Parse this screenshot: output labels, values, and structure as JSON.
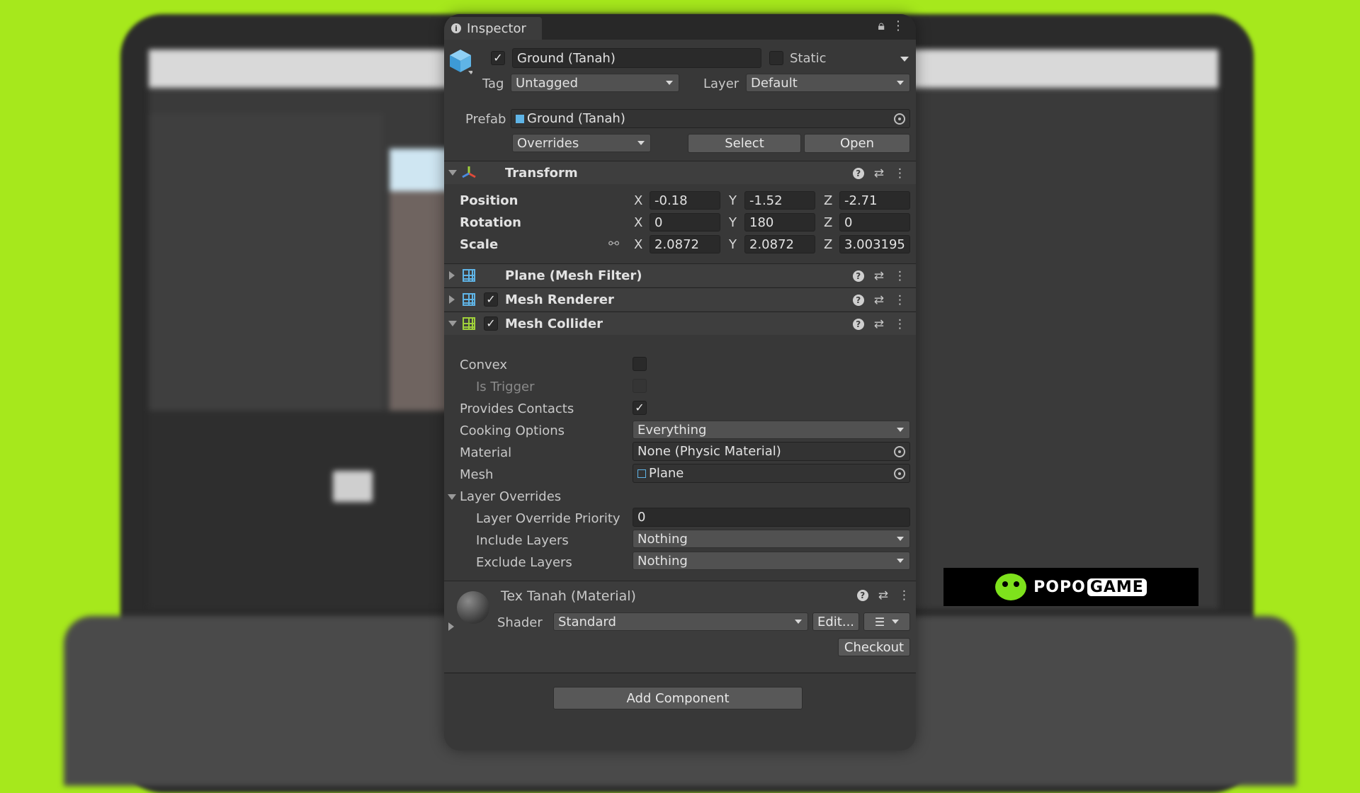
{
  "inspector": {
    "tab_label": "Inspector",
    "object": {
      "name": "Ground (Tanah)",
      "enabled": true,
      "static_label": "Static",
      "static_checked": false,
      "tag_label": "Tag",
      "tag_value": "Untagged",
      "layer_label": "Layer",
      "layer_value": "Default",
      "prefab_label": "Prefab",
      "prefab_value": "Ground (Tanah)",
      "overrides_label": "Overrides",
      "select_label": "Select",
      "open_label": "Open"
    },
    "transform": {
      "title": "Transform",
      "rows": [
        {
          "label": "Position",
          "x": "-0.18",
          "y": "-1.52",
          "z": "-2.71"
        },
        {
          "label": "Rotation",
          "x": "0",
          "y": "180",
          "z": "0"
        },
        {
          "label": "Scale",
          "x": "2.0872",
          "y": "2.0872",
          "z": "3.003195"
        }
      ],
      "axis_x": "X",
      "axis_y": "Y",
      "axis_z": "Z"
    },
    "components": {
      "mesh_filter": {
        "title": "Plane (Mesh Filter)"
      },
      "mesh_renderer": {
        "title": "Mesh Renderer",
        "enabled": true
      },
      "mesh_collider": {
        "title": "Mesh Collider",
        "enabled": true
      }
    },
    "collider": {
      "convex_label": "Convex",
      "convex_checked": false,
      "is_trigger_label": "Is Trigger",
      "provides_contacts_label": "Provides Contacts",
      "provides_contacts_checked": true,
      "cooking_options_label": "Cooking Options",
      "cooking_options_value": "Everything",
      "material_label": "Material",
      "material_value": "None (Physic Material)",
      "mesh_label": "Mesh",
      "mesh_value": "Plane",
      "layer_overrides_label": "Layer Overrides",
      "layer_override_priority_label": "Layer Override Priority",
      "layer_override_priority_value": "0",
      "include_layers_label": "Include Layers",
      "include_layers_value": "Nothing",
      "exclude_layers_label": "Exclude Layers",
      "exclude_layers_value": "Nothing"
    },
    "material": {
      "title": "Tex Tanah (Material)",
      "shader_label": "Shader",
      "shader_value": "Standard",
      "edit_label": "Edit...",
      "checkout_label": "Checkout"
    },
    "add_component_label": "Add Component"
  },
  "watermark": {
    "part1": "POPO",
    "part2": "GAME"
  },
  "colors": {
    "background": "#a6e81c",
    "panel": "#383838",
    "accent_blue": "#5fb4e6",
    "accent_green": "#9fd03a"
  }
}
